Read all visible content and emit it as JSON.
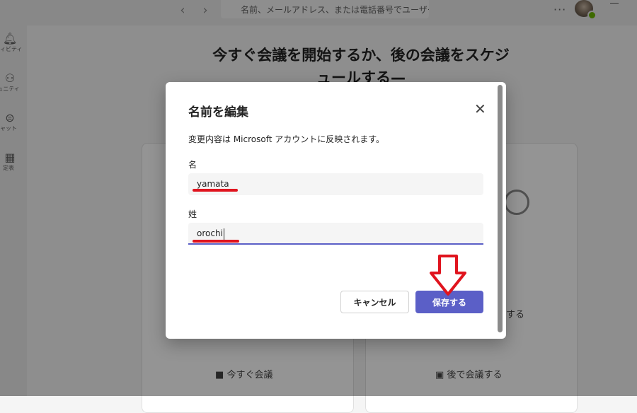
{
  "app": {
    "search_placeholder": "名前、メールアドレス、または電話番号でユーザーを",
    "nav_back_icon": "chevron-left-icon",
    "nav_forward_icon": "chevron-right-icon",
    "more_icon": "ellipsis-icon"
  },
  "rail": {
    "items": [
      {
        "icon": "bell-icon",
        "label": "ティビティ"
      },
      {
        "icon": "people-icon",
        "label": "ュニティ"
      },
      {
        "icon": "chat-icon",
        "label": "ャット"
      },
      {
        "icon": "calendar-icon",
        "label": "定表"
      }
    ]
  },
  "main": {
    "heading_line1": "今すぐ会議を開始するか、後の会議をスケジ",
    "heading_line2": "ュールする—",
    "meet_now_label": "今すぐ会議",
    "schedule_label": "後で会議する",
    "partial_label": "する"
  },
  "dialog": {
    "title": "名前を編集",
    "description": "変更内容は Microsoft アカウントに反映されます。",
    "first_name_label": "名",
    "first_name_value": "yamata",
    "last_name_label": "姓",
    "last_name_value": "orochi",
    "cancel_label": "キャンセル",
    "save_label": "保存する"
  },
  "colors": {
    "accent": "#5b5fc7",
    "annotation_red": "#e0141e",
    "overlay": "rgba(0,0,0,0.42)"
  }
}
